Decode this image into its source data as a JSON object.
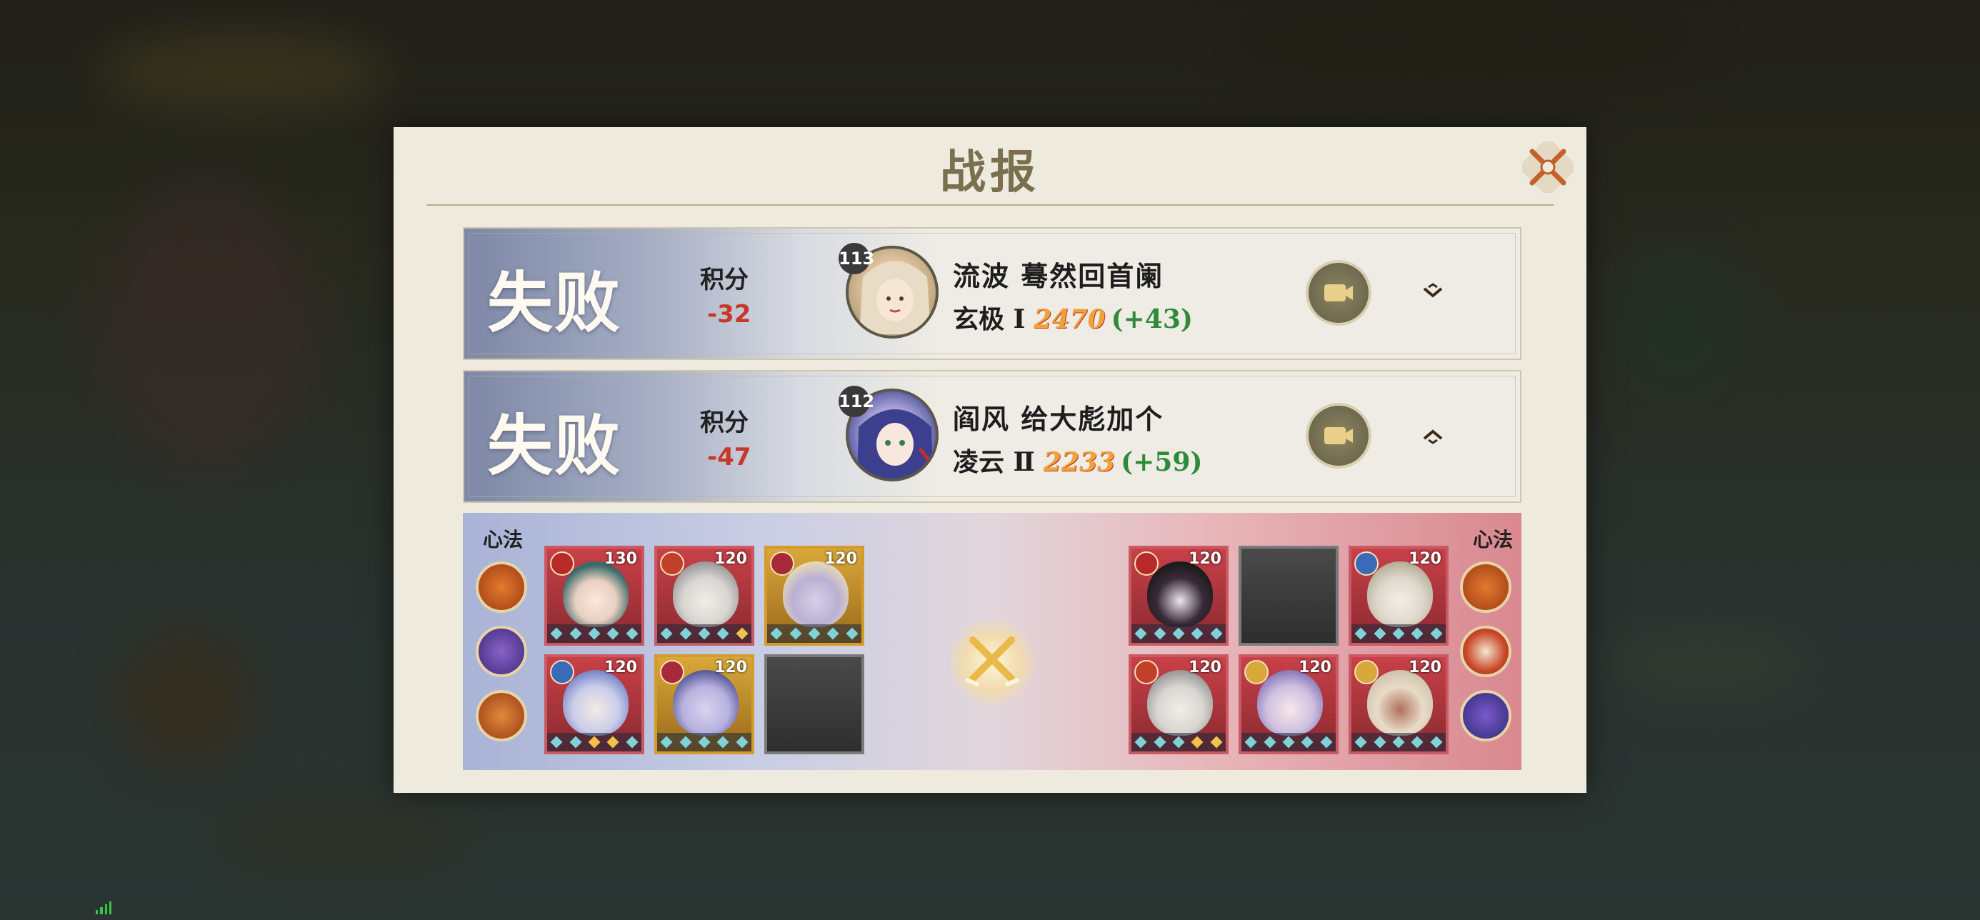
{
  "dialog": {
    "title": "战报",
    "close_icon": "close-x-icon"
  },
  "records": [
    {
      "result": "失败",
      "score_label": "积分",
      "score_delta": "-32",
      "opponent_level": "113",
      "opponent_name": "流波 蓦然回首阑",
      "rank_tier": "玄极 Ⅰ",
      "rank_points": "2470",
      "rank_gain": "(+43)",
      "replay_icon": "video-camera-icon",
      "toggle_icon": "chevron-down-icon"
    },
    {
      "result": "失败",
      "score_label": "积分",
      "score_delta": "-47",
      "opponent_level": "112",
      "opponent_name": "阎风 给大彪加个",
      "rank_tier": "凌云 Ⅱ",
      "rank_points": "2233",
      "rank_gain": "(+59)",
      "replay_icon": "video-camera-icon",
      "toggle_icon": "chevron-up-icon"
    }
  ],
  "detail": {
    "left_label": "心法",
    "right_label": "心法",
    "vs_icon": "crossed-swords-icon",
    "left_heroes": [
      {
        "level": "130"
      },
      {
        "level": "120"
      },
      {
        "level": "120"
      },
      {
        "level": "120"
      },
      {
        "level": "120"
      }
    ],
    "right_heroes": [
      {
        "level": "120"
      },
      {
        "level": "120"
      },
      {
        "level": "120"
      },
      {
        "level": "120"
      },
      {
        "level": "120"
      }
    ]
  },
  "colors": {
    "loss_red": "#c8382a",
    "gain_green": "#2f8a3a",
    "points_orange": "#f0a23a",
    "title_brown": "#7a6f4e"
  }
}
